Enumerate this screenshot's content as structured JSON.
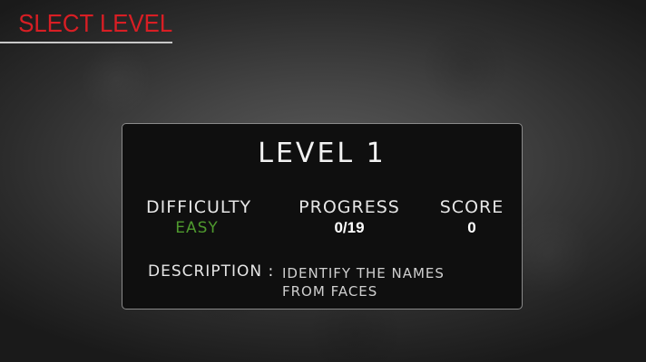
{
  "header": {
    "title": "SLECT LEVEL"
  },
  "level_card": {
    "title": "LEVEL 1",
    "difficulty": {
      "label": "DIFFICULTY",
      "value": "EASY"
    },
    "progress": {
      "label": "PROGRESS",
      "value": "0/19"
    },
    "score": {
      "label": "SCORE",
      "value": "0"
    },
    "description": {
      "label": "DESCRIPTION :",
      "text": "IDENTIFY THE NAMES FROM FACES"
    }
  },
  "colors": {
    "header_title": "#d81e24",
    "difficulty_easy": "#4f9a2e",
    "card_background": "#0f0f0f"
  }
}
